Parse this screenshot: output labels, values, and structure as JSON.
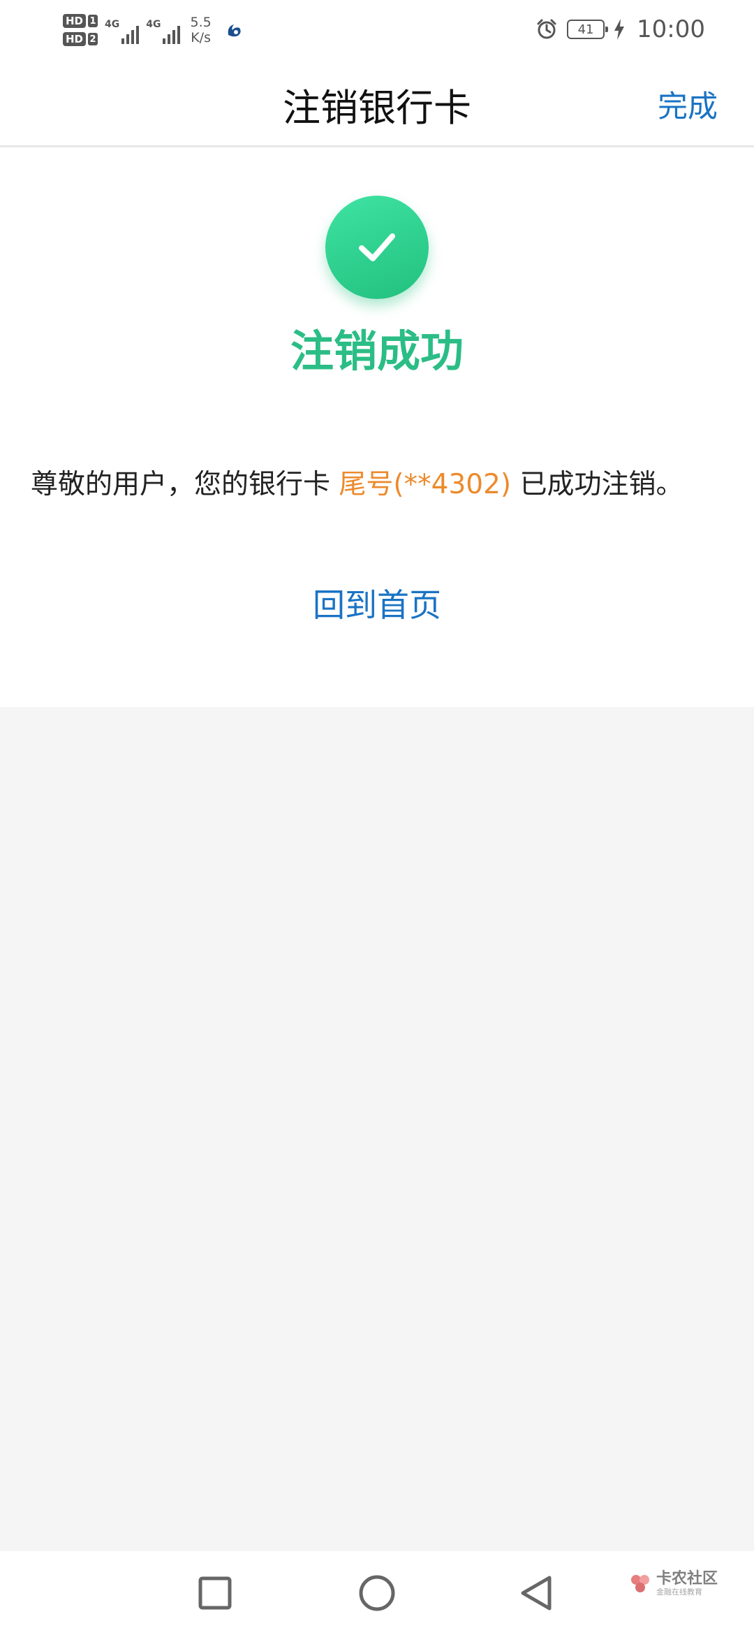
{
  "status_bar": {
    "hd1": "HD",
    "sim1": "1",
    "hd2": "HD",
    "sim2": "2",
    "net1": "4G",
    "net2": "4G",
    "speed_value": "5.5",
    "speed_unit": "K/s",
    "battery": "41",
    "time": "10:00",
    "icons": [
      "alarm-icon",
      "charging-icon",
      "app-notification-icon"
    ]
  },
  "nav": {
    "title": "注销银行卡",
    "done_label": "完成"
  },
  "result": {
    "icon": "check-icon",
    "title": "注销成功",
    "message_prefix": "尊敬的用户，您的银行卡",
    "card_tail": "尾号(**4302)",
    "message_suffix": "已成功注销。",
    "home_link": "回到首页"
  },
  "colors": {
    "accent_blue": "#1a73c4",
    "success_green": "#2bbd86",
    "highlight_orange": "#ec8a2c"
  },
  "system_nav": {
    "buttons": [
      "recent-apps-icon",
      "home-icon",
      "back-icon"
    ]
  },
  "watermark": {
    "main": "卡农社区",
    "sub": "金融在线教育"
  }
}
